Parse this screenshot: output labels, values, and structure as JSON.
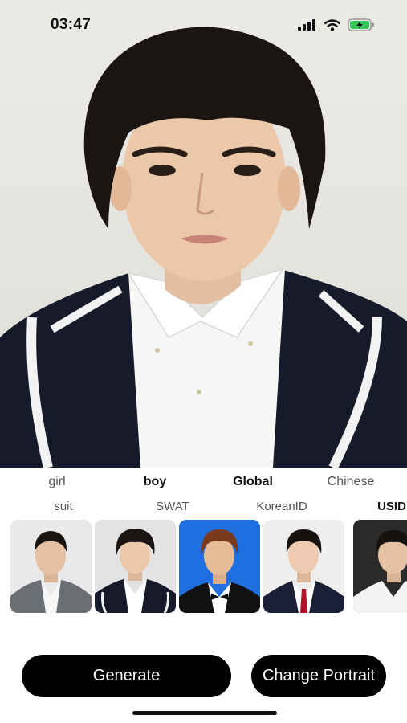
{
  "status_bar": {
    "time": "03:47",
    "icons": [
      "cellular-signal-icon",
      "wifi-icon",
      "battery-charging-icon"
    ],
    "battery_color": "#34c759"
  },
  "portrait": {
    "subject": "portrait-photo"
  },
  "categories": {
    "primary": [
      {
        "label": "girl",
        "selected": false
      },
      {
        "label": "boy",
        "selected": true
      },
      {
        "label": "Global",
        "selected": true
      },
      {
        "label": "Chinese",
        "selected": false
      }
    ],
    "styles": [
      {
        "label": "suit",
        "selected": false
      },
      {
        "label": "SWAT",
        "selected": false
      },
      {
        "label": "KoreanID",
        "selected": false
      },
      {
        "label": "USID",
        "selected": true
      }
    ]
  },
  "templates": [
    {
      "name": "template-gray-suit",
      "background": "#e9e9e9"
    },
    {
      "name": "template-navy-blazer",
      "background": "#e3e3e3"
    },
    {
      "name": "template-blue-bowtie",
      "background": "#1f6fe0"
    },
    {
      "name": "template-red-tie",
      "background": "#eeeeee"
    },
    {
      "name": "template-white-shirt",
      "background": "#2b2b2b"
    }
  ],
  "actions": {
    "generate_label": "Generate",
    "change_portrait_label": "Change Portrait"
  },
  "colors": {
    "button_bg": "#000000",
    "button_text": "#ffffff",
    "selected_text": "#111111",
    "unselected_text": "#555555"
  }
}
